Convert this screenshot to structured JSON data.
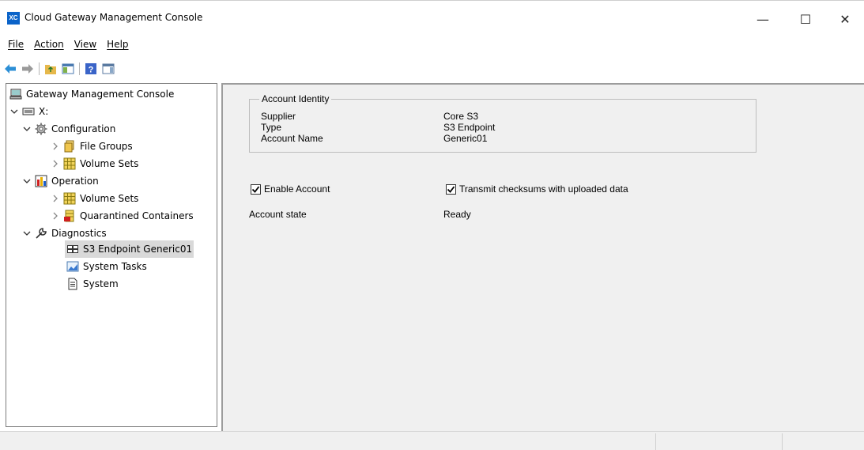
{
  "window": {
    "title": "Cloud Gateway Management Console",
    "app_icon_text": "XC",
    "minimize": "—",
    "maximize": "☐",
    "close": "✕"
  },
  "menu": [
    "File",
    "Action",
    "View",
    "Help"
  ],
  "toolbar": {
    "buttons": [
      "back-icon",
      "forward-icon",
      "up-folder-icon",
      "show-hide-console-tree-icon",
      "help-icon",
      "show-hide-action-pane-icon"
    ]
  },
  "tree": {
    "root": "Gateway Management Console",
    "drive": "X:",
    "configuration": "Configuration",
    "file_groups": "File Groups",
    "volume_sets_config": "Volume Sets",
    "operation": "Operation",
    "volume_sets_op": "Volume Sets",
    "quarantined": "Quarantined Containers",
    "diagnostics": "Diagnostics",
    "s3_endpoint": "S3 Endpoint Generic01",
    "system_tasks": "System Tasks",
    "system": "System"
  },
  "account": {
    "group_title": "Account Identity",
    "supplier_label": "Supplier",
    "supplier_value": "Core S3",
    "type_label": "Type",
    "type_value": "S3 Endpoint",
    "name_label": "Account Name",
    "name_value": "Generic01",
    "enable_label": "Enable Account",
    "enable_checked": true,
    "checksum_label": "Transmit checksums with uploaded data",
    "checksum_checked": true,
    "state_label": "Account state",
    "state_value": "Ready"
  },
  "colors": {
    "selection": "#d9d9d9",
    "pane_bg": "#f0f0f0",
    "accent": "#0a63c9"
  }
}
